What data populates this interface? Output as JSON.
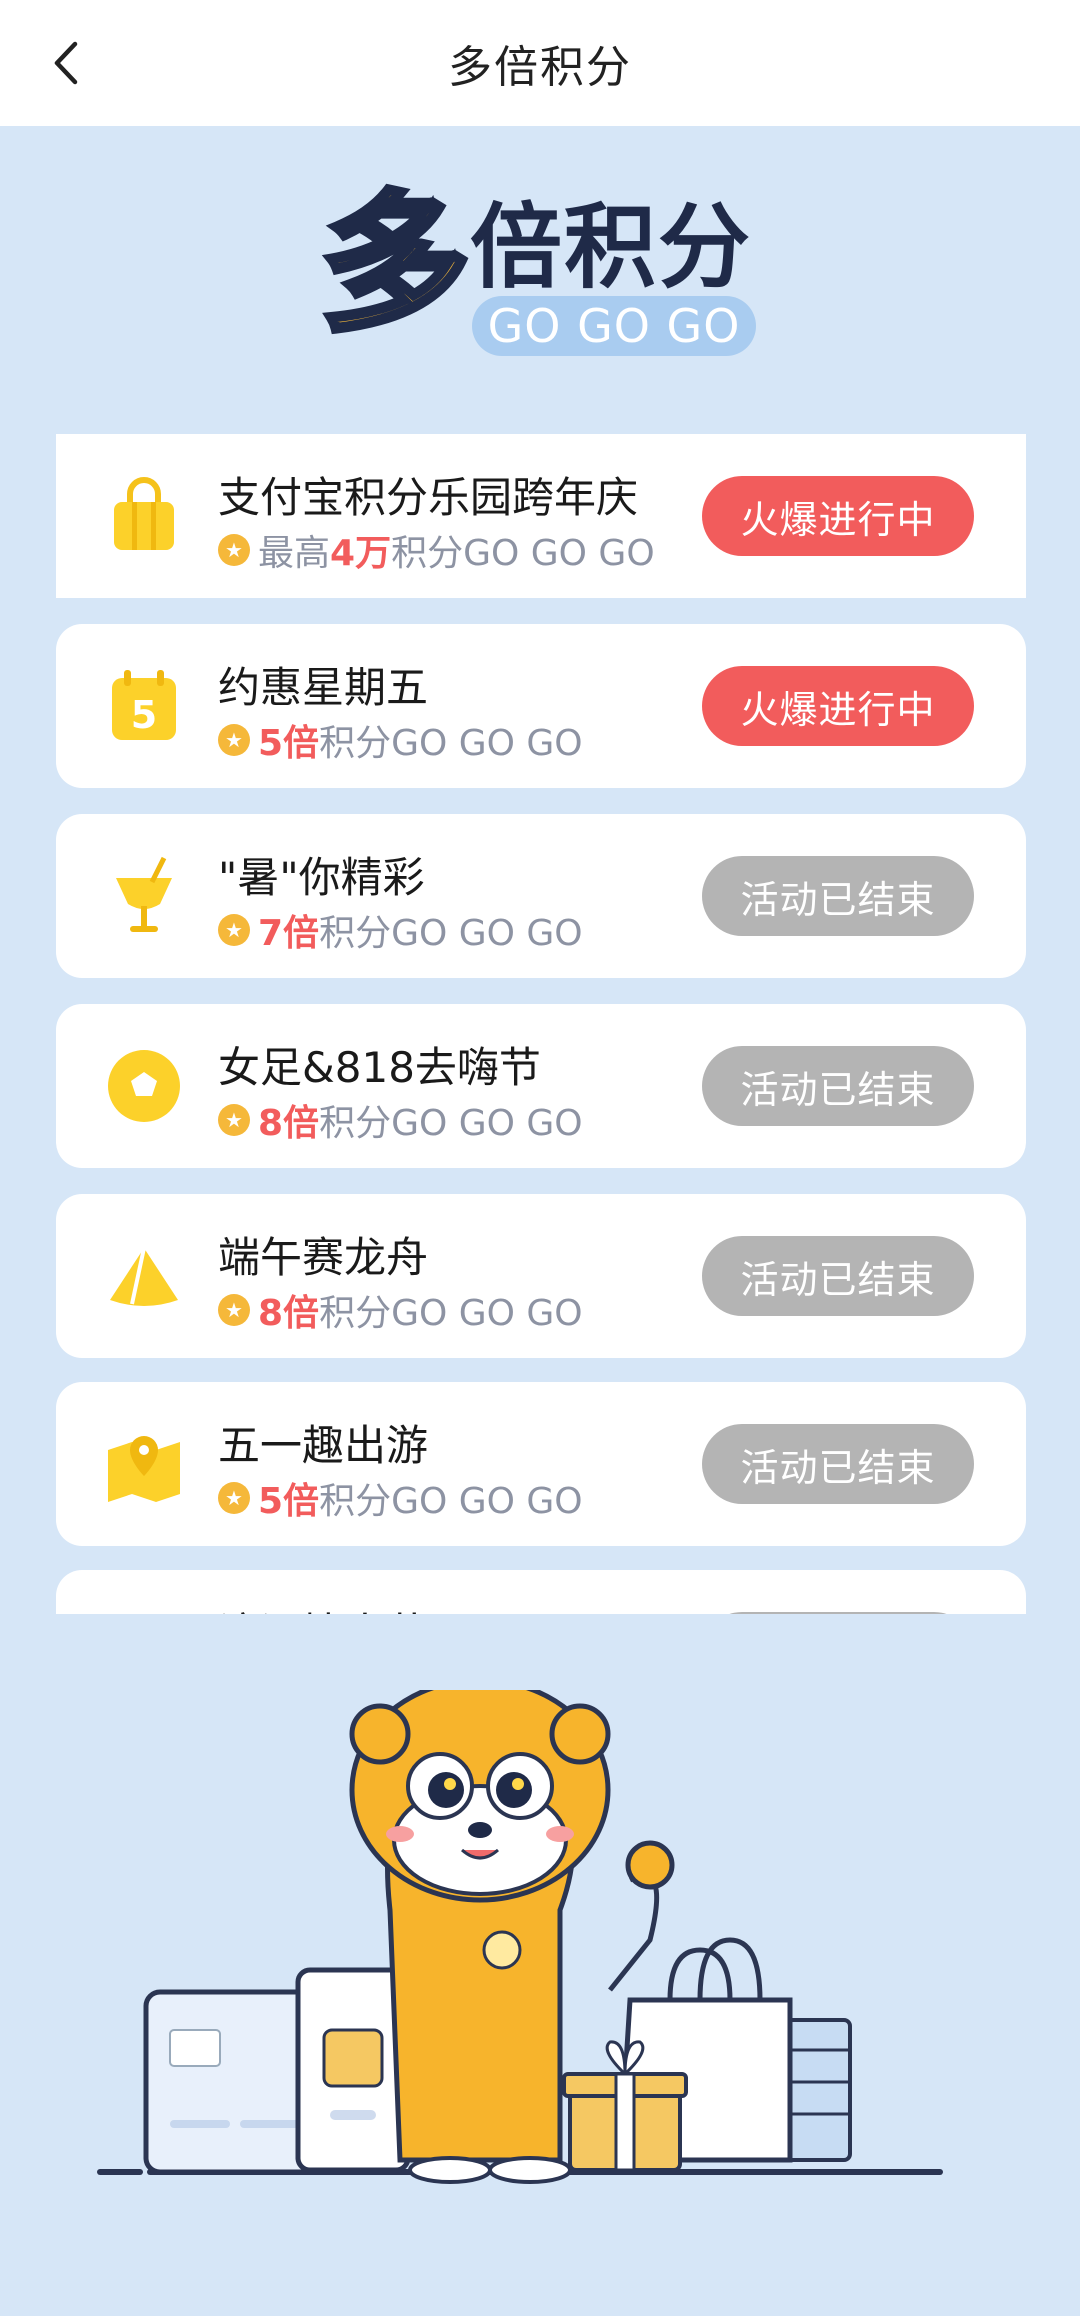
{
  "nav": {
    "title": "多倍积分"
  },
  "logo": {
    "main_char": "多",
    "rest": "倍积分",
    "tagline": "GO GO GO"
  },
  "activities": [
    {
      "name": "支付宝积分乐园跨年庆",
      "prefix": "最高",
      "value": "4万",
      "suffix": "积分GO GO GO",
      "status": "火爆进行中",
      "state": "hot",
      "icon": "shopping-bag-icon"
    },
    {
      "name": "约惠星期五",
      "prefix": "",
      "value": "5倍",
      "suffix": "积分GO GO GO",
      "status": "火爆进行中",
      "state": "hot",
      "icon": "calendar-icon"
    },
    {
      "name": "\"暑\"你精彩",
      "prefix": "",
      "value": "7倍",
      "suffix": "积分GO GO GO",
      "status": "活动已结束",
      "state": "ended",
      "icon": "cold-drink-icon"
    },
    {
      "name": "女足&818去嗨节",
      "prefix": "",
      "value": "8倍",
      "suffix": "积分GO GO GO",
      "status": "活动已结束",
      "state": "ended",
      "icon": "soccer-ball-icon"
    },
    {
      "name": "端午赛龙舟",
      "prefix": "",
      "value": "8倍",
      "suffix": "积分GO GO GO",
      "status": "活动已结束",
      "state": "ended",
      "icon": "zongzi-icon"
    },
    {
      "name": "五一趣出游",
      "prefix": "",
      "value": "5倍",
      "suffix": "积分GO GO GO",
      "status": "活动已结束",
      "state": "ended",
      "icon": "map-pin-icon"
    },
    {
      "name": "浪漫情人节",
      "prefix": "",
      "value": "",
      "suffix": "",
      "status": "",
      "state": "ended",
      "icon": "heart-icon"
    }
  ],
  "colors": {
    "background": "#d6e6f7",
    "hot": "#f25c5c",
    "ended": "#b4b4b4",
    "accent": "#f5b83a",
    "brand_dark": "#1f2a48"
  }
}
